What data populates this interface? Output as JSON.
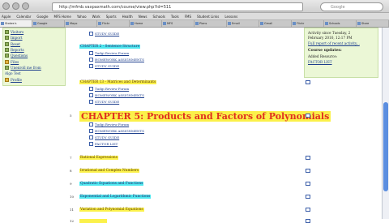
{
  "browser": {
    "url": "http://mfmb.vaxpaxmath.com/course/view.php?id=511",
    "search_placeholder": "Google",
    "bookmarks": [
      "Apple",
      "Calendar",
      "Google",
      "MFS Home",
      "Yahoo",
      "Work",
      "Sports",
      "Health",
      "News",
      "Schools",
      "Tools",
      "FMS",
      "Student Links",
      "Lessons"
    ],
    "tabs": [
      "Stokes's",
      "Google",
      "Mayo",
      "Flickr",
      "Home",
      "MFS",
      "Plans",
      "Email",
      "Gmail",
      "Flickr",
      "Schools",
      "Store"
    ]
  },
  "sidebar": {
    "items": [
      {
        "label": "Visitors",
        "kind": "link"
      },
      {
        "label": "Import",
        "kind": "link"
      },
      {
        "label": "Reset",
        "kind": "link"
      },
      {
        "label": "Reports",
        "kind": "link"
      },
      {
        "label": "Questions",
        "kind": "link"
      },
      {
        "label": "Files",
        "kind": "special"
      },
      {
        "label": "Unenroll me from",
        "kind": "link"
      },
      {
        "label": "Algo Test",
        "kind": "plain"
      },
      {
        "label": "Profile",
        "kind": "special"
      }
    ]
  },
  "main": {
    "top_link": "STUDY GUIDE",
    "rows": [
      {
        "num": "",
        "title": "CHAPTER 2 - Sentence Structure",
        "style": "cyan",
        "links": [
          "Tudgi Review Forum",
          "HOMEWORK ASSIGNMENTS",
          "STUDY GUIDE"
        ]
      },
      {
        "num": "",
        "title": "CHAPTER 13 - Matrices and Determinants",
        "style": "yellow",
        "links": [
          "Tudgi Review Forum",
          "HOMEWORK ASSIGNMENTS",
          "STUDY GUIDE"
        ]
      },
      {
        "num": "5",
        "title": "CHAPTER 5: Products and Factors of Polynomials",
        "style": "big",
        "links": [
          "Tudgi Review Forum",
          "HOMEWORK ASSIGNMENTS",
          "STUDY GUIDE",
          "FACTOR LIST"
        ]
      },
      {
        "num": "7",
        "title": "Rational Expressions",
        "style": "yellow"
      },
      {
        "num": "8",
        "title": "Irrational and Complex Numbers",
        "style": "yellow"
      },
      {
        "num": "9",
        "title": "Quadratic Equations and Functions",
        "style": "cyan"
      },
      {
        "num": "10",
        "title": "Exponential and Logarithmic Functions",
        "style": "cyan"
      },
      {
        "num": "11",
        "title": "Variation and Polynomial Equations",
        "style": "yellow"
      },
      {
        "num": "12",
        "title": "",
        "style": "yellow"
      }
    ]
  },
  "rightbox": {
    "lines": [
      "Activity since Tuesday, 2",
      "February 2010, 12:17 PM"
    ],
    "activity_link": "Full report of recent activity...",
    "heading": "Course updates:",
    "added": "Added Resource:",
    "factor_link": "FACTOR LIST"
  }
}
